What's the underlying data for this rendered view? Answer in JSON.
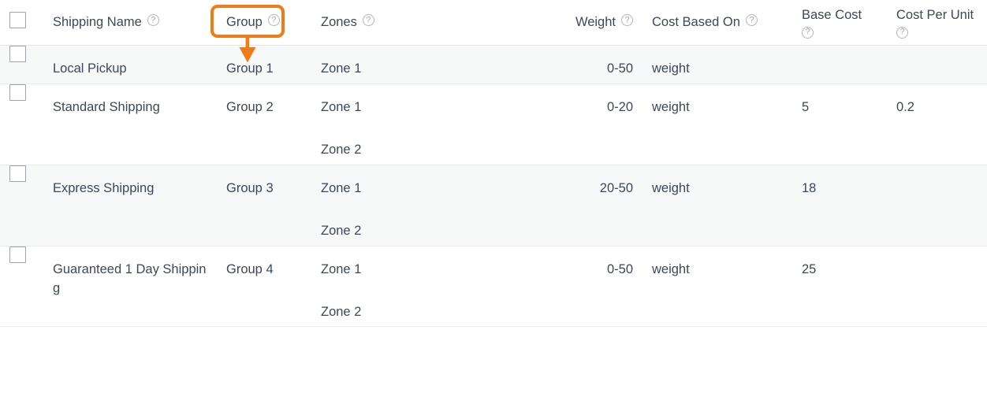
{
  "table": {
    "columns": [
      {
        "key": "select",
        "label": "",
        "align": "left",
        "has_help": false,
        "help_below": false
      },
      {
        "key": "name",
        "label": "Shipping Name",
        "align": "left",
        "has_help": true,
        "help_below": false
      },
      {
        "key": "group",
        "label": "Group",
        "align": "left",
        "has_help": true,
        "help_below": false
      },
      {
        "key": "zones",
        "label": "Zones",
        "align": "left",
        "has_help": true,
        "help_below": false
      },
      {
        "key": "weight",
        "label": "Weight",
        "align": "right",
        "has_help": true,
        "help_below": false
      },
      {
        "key": "basis",
        "label": "Cost Based On",
        "align": "left",
        "has_help": true,
        "help_below": false
      },
      {
        "key": "basecost",
        "label": "Base Cost",
        "align": "left",
        "has_help": true,
        "help_below": true
      },
      {
        "key": "unitcost",
        "label": "Cost Per Unit",
        "align": "left",
        "has_help": true,
        "help_below": true
      }
    ],
    "rows": [
      {
        "selected": false,
        "name": "Local Pickup",
        "group": "Group 1",
        "zones": [
          "Zone 1"
        ],
        "weight": "0-50",
        "basis": "weight",
        "base_cost": "",
        "cost_per_unit": ""
      },
      {
        "selected": false,
        "name": "Standard Shipping",
        "group": "Group 2",
        "zones": [
          "Zone 1",
          "Zone 2"
        ],
        "weight": "0-20",
        "basis": "weight",
        "base_cost": "5",
        "cost_per_unit": "0.2"
      },
      {
        "selected": false,
        "name": "Express Shipping",
        "group": "Group 3",
        "zones": [
          "Zone 1",
          "Zone 2"
        ],
        "weight": "20-50",
        "basis": "weight",
        "base_cost": "18",
        "cost_per_unit": ""
      },
      {
        "selected": false,
        "name": "Guaranteed 1 Day Shipping",
        "group": "Group 4",
        "zones": [
          "Zone 1",
          "Zone 2"
        ],
        "weight": "0-50",
        "basis": "weight",
        "base_cost": "25",
        "cost_per_unit": ""
      }
    ]
  },
  "annotation": {
    "highlight_target": "Group",
    "arrow_target": "Group 1",
    "color": "#f07c18"
  },
  "icons": {
    "help": "help-circle-icon",
    "arrow": "down-arrow-annotation-icon",
    "checkbox": "checkbox-icon"
  },
  "colors": {
    "accent": "#f07c18",
    "text": "#3c4858",
    "row_alt_bg": "#f7f8f8",
    "row_bg": "#ffffff",
    "border": "#ebebeb",
    "help_icon": "#a8a8a8",
    "checkbox_border": "#9aa5b1"
  }
}
